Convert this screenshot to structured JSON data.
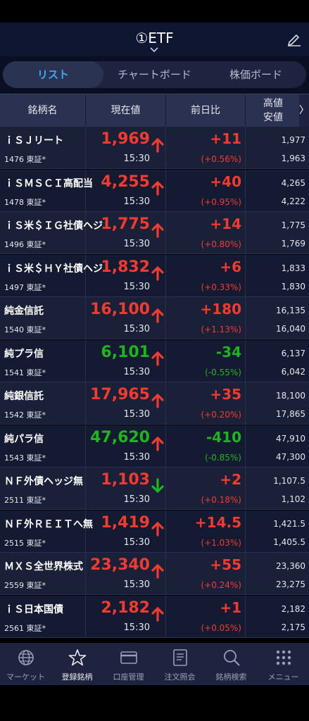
{
  "header": {
    "title": "①ETF"
  },
  "tabs": [
    {
      "label": "リスト",
      "active": true
    },
    {
      "label": "チャートボード",
      "active": false
    },
    {
      "label": "株価ボード",
      "active": false
    }
  ],
  "columns": {
    "name": "銘柄名",
    "price": "現在値",
    "change": "前日比",
    "high": "高値",
    "low": "安値",
    "more": "〉"
  },
  "rows": [
    {
      "name": "ｉＳＪリート",
      "code": "1476 東証*",
      "price": "1,969",
      "price_color": "up",
      "direction": "up",
      "time": "15:30",
      "change": "+11",
      "pct": "(+0.56%)",
      "change_color": "up",
      "high": "1,977",
      "low": "1,963"
    },
    {
      "name": "ｉＳＭＳＣＩ高配当",
      "code": "1478 東証*",
      "price": "4,255",
      "price_color": "up",
      "direction": "up",
      "time": "15:30",
      "change": "+40",
      "pct": "(+0.95%)",
      "change_color": "up",
      "high": "4,265",
      "low": "4,222"
    },
    {
      "name": "ｉＳ米＄ＩＧ社債ヘジ",
      "code": "1496 東証*",
      "price": "1,775",
      "price_color": "up",
      "direction": "up",
      "time": "15:30",
      "change": "+14",
      "pct": "(+0.80%)",
      "change_color": "up",
      "high": "1,775",
      "low": "1,769"
    },
    {
      "name": "ｉＳ米＄ＨＹ社債ヘジ",
      "code": "1497 東証*",
      "price": "1,832",
      "price_color": "up",
      "direction": "up",
      "time": "15:30",
      "change": "+6",
      "pct": "(+0.33%)",
      "change_color": "up",
      "high": "1,833",
      "low": "1,830"
    },
    {
      "name": "純金信託",
      "code": "1540 東証*",
      "price": "16,100",
      "price_color": "up",
      "direction": "up",
      "time": "15:30",
      "change": "+180",
      "pct": "(+1.13%)",
      "change_color": "up",
      "high": "16,135",
      "low": "16,040"
    },
    {
      "name": "純プラ信",
      "code": "1541 東証*",
      "price": "6,101",
      "price_color": "down",
      "direction": "up",
      "time": "15:30",
      "change": "-34",
      "pct": "(-0.55%)",
      "change_color": "down",
      "high": "6,137",
      "low": "6,042"
    },
    {
      "name": "純銀信託",
      "code": "1542 東証*",
      "price": "17,965",
      "price_color": "up",
      "direction": "up",
      "time": "15:30",
      "change": "+35",
      "pct": "(+0.20%)",
      "change_color": "up",
      "high": "18,100",
      "low": "17,865"
    },
    {
      "name": "純パラ信",
      "code": "1543 東証*",
      "price": "47,620",
      "price_color": "down",
      "direction": "up",
      "time": "15:30",
      "change": "-410",
      "pct": "(-0.85%)",
      "change_color": "down",
      "high": "47,910",
      "low": "47,300"
    },
    {
      "name": "ＮＦ外債ヘッジ無",
      "code": "2511 東証*",
      "price": "1,103",
      "price_color": "up",
      "direction": "down",
      "time": "15:30",
      "change": "+2",
      "pct": "(+0.18%)",
      "change_color": "up",
      "high": "1,107.5",
      "low": "1,102"
    },
    {
      "name": "ＮＦ外ＲＥＩＴへ無",
      "code": "2515 東証*",
      "price": "1,419",
      "price_color": "up",
      "direction": "up",
      "time": "15:30",
      "change": "+14.5",
      "pct": "(+1.03%)",
      "change_color": "up",
      "high": "1,421.5",
      "low": "1,405.5"
    },
    {
      "name": "ＭＸＳ全世界株式",
      "code": "2559 東証*",
      "price": "23,340",
      "price_color": "up",
      "direction": "up",
      "time": "15:30",
      "change": "+55",
      "pct": "(+0.24%)",
      "change_color": "up",
      "high": "23,360",
      "low": "23,275"
    },
    {
      "name": "ｉＳ日本国債",
      "code": "2561 東証*",
      "price": "2,182",
      "price_color": "up",
      "direction": "up",
      "time": "15:30",
      "change": "+1",
      "pct": "(+0.05%)",
      "change_color": "up",
      "high": "2,182",
      "low": "2,175"
    }
  ],
  "bottom_nav": [
    {
      "label": "マーケット",
      "icon": "globe-icon",
      "active": false
    },
    {
      "label": "登録銘柄",
      "icon": "star-icon",
      "active": true
    },
    {
      "label": "口座管理",
      "icon": "card-icon",
      "active": false
    },
    {
      "label": "注文照会",
      "icon": "document-icon",
      "active": false
    },
    {
      "label": "銘柄検索",
      "icon": "search-icon",
      "active": false
    },
    {
      "label": "メニュー",
      "icon": "grid-icon",
      "active": false
    }
  ],
  "colors": {
    "up": "#f23b2f",
    "down": "#1fb51f",
    "accent": "#3fa8f4",
    "header_bg": "#0f1631"
  }
}
